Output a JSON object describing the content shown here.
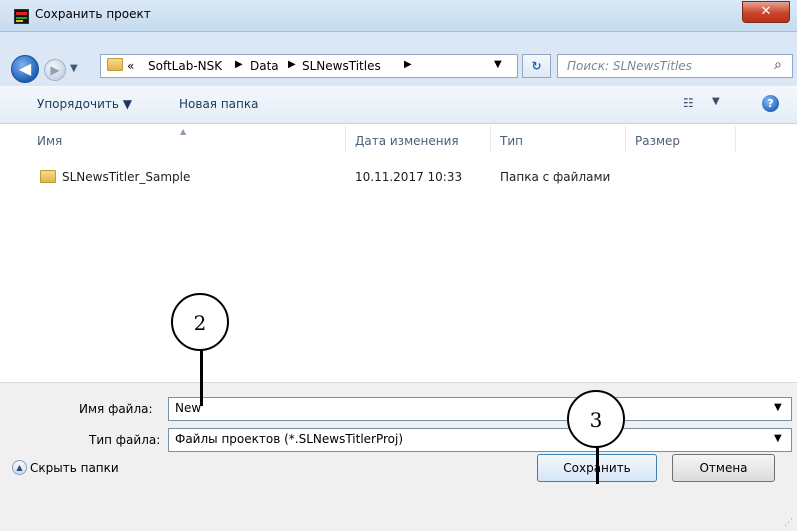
{
  "window": {
    "title": "Сохранить проект",
    "close_label": "✕"
  },
  "nav": {
    "back_icon": "◀",
    "forward_icon": "▶",
    "history_icon": "▼",
    "breadcrumb_more": "«",
    "breadcrumbs": [
      "SoftLab-NSK",
      "Data",
      "SLNewsTitles"
    ],
    "breadcrumb_separator": "▶",
    "address_dropdown_icon": "▼",
    "refresh_icon": "↻",
    "search_placeholder": "Поиск: SLNewsTitles",
    "search_icon": "⌕"
  },
  "toolbar": {
    "organize_label": "Упорядочить ▼",
    "new_folder_label": "Новая папка",
    "views_icon": "☷",
    "views_arrow": "▼",
    "help_label": "?"
  },
  "filelist": {
    "sort_arrow": "▲",
    "columns": [
      "Имя",
      "Дата изменения",
      "Тип",
      "Размер"
    ],
    "rows": [
      {
        "name": "SLNewsTitler_Sample",
        "date": "10.11.2017 10:33",
        "type": "Папка с файлами",
        "size": ""
      }
    ]
  },
  "form": {
    "filename_label": "Имя файла:",
    "filename_value": "New",
    "filetype_label": "Тип файла:",
    "filetype_value": "Файлы проектов (*.SLNewsTitlerProj)",
    "dropdown_arrow": "▼",
    "hide_folders_icon": "▲",
    "hide_folders_label": "Скрыть папки",
    "save_label": "Сохранить",
    "cancel_label": "Отмена",
    "grip": "⋰"
  },
  "callouts": {
    "filename_marker": "2",
    "save_marker": "3"
  },
  "colors": {
    "titlebar": "#c6dbef",
    "close_button": "#c8442a",
    "save_button_border": "#3c7fb1"
  }
}
